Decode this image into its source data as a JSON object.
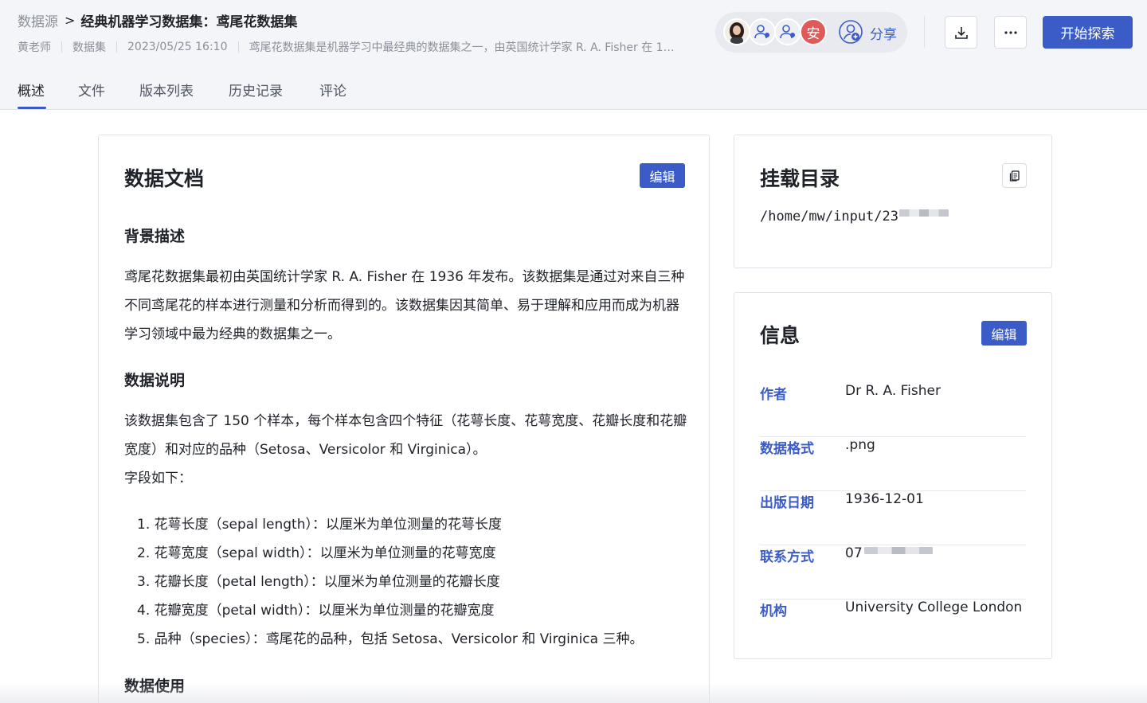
{
  "header": {
    "breadcrumb_root": "数据源",
    "breadcrumb_sep": ">",
    "title": "经典机器学习数据集：鸢尾花数据集",
    "author": "黄老师",
    "type": "数据集",
    "timestamp": "2023/05/25 16:10",
    "description": "鸢尾花数据集是机器学习中最经典的数据集之一，由英国统计学家 R. A. Fisher 在 1…",
    "avatar_letter": "安",
    "share_label": "分享",
    "explore_label": "开始探索",
    "accent_color": "#3b5cc6"
  },
  "tabs": [
    {
      "label": "概述",
      "active": true
    },
    {
      "label": "文件",
      "active": false
    },
    {
      "label": "版本列表",
      "active": false
    },
    {
      "label": "历史记录",
      "active": false
    },
    {
      "label": "评论",
      "active": false
    }
  ],
  "doc": {
    "title": "数据文档",
    "edit_label": "编辑",
    "bg_heading": "背景描述",
    "bg_text": "鸢尾花数据集最初由英国统计学家 R. A. Fisher 在 1936 年发布。该数据集是通过对来自三种不同鸢尾花的样本进行测量和分析而得到的。该数据集因其简单、易于理解和应用而成为机器学习领域中最为经典的数据集之一。",
    "data_heading": "数据说明",
    "data_text": "该数据集包含了 150 个样本，每个样本包含四个特征（花萼长度、花萼宽度、花瓣长度和花瓣宽度）和对应的品种（Setosa、Versicolor 和 Virginica）。",
    "fields_intro": "字段如下：",
    "fields": [
      "1. 花萼长度（sepal length）：以厘米为单位测量的花萼长度",
      "2. 花萼宽度（sepal width）：以厘米为单位测量的花萼宽度",
      "3. 花瓣长度（petal length）：以厘米为单位测量的花瓣长度",
      "4. 花瓣宽度（petal width）：以厘米为单位测量的花瓣宽度",
      "5. 品种（species）：鸢尾花的品种，包括 Setosa、Versicolor 和 Virginica 三种。"
    ],
    "usage_heading": "数据使用"
  },
  "mount": {
    "title": "挂载目录",
    "path": "/home/mw/input/23"
  },
  "info": {
    "title": "信息",
    "edit_label": "编辑",
    "rows": [
      {
        "key": "作者",
        "value": "Dr R. A. Fisher"
      },
      {
        "key": "数据格式",
        "value": ".png"
      },
      {
        "key": "出版日期",
        "value": "1936-12-01"
      },
      {
        "key": "联系方式",
        "value": "07"
      },
      {
        "key": "机构",
        "value": "University College London"
      }
    ]
  }
}
